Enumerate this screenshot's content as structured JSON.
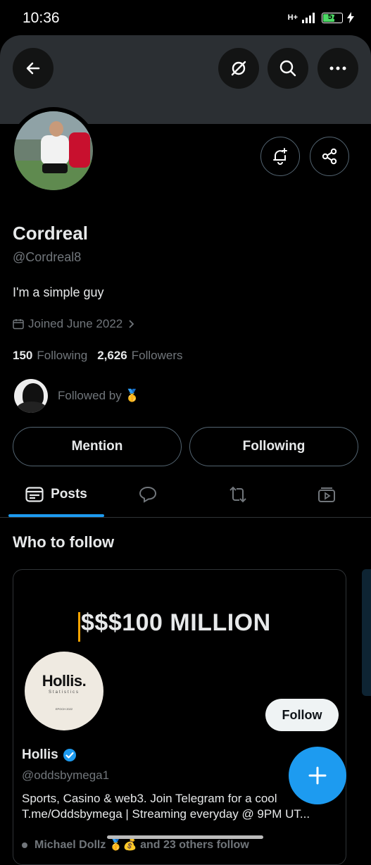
{
  "status_bar": {
    "time": "10:36",
    "network": "H+",
    "battery": "57"
  },
  "profile": {
    "name": "Cordreal",
    "handle": "@Cordreal8",
    "bio": "I'm a simple guy",
    "joined": "Joined June 2022",
    "following_count": "150",
    "following_label": "Following",
    "followers_count": "2,626",
    "followers_label": "Followers",
    "followed_by": "Followed by 🥇"
  },
  "actions": {
    "mention": "Mention",
    "following": "Following"
  },
  "tabs": [
    {
      "label": "Posts",
      "icon": "posts-icon"
    },
    {
      "icon": "replies-icon"
    },
    {
      "icon": "repost-icon"
    },
    {
      "icon": "media-icon"
    }
  ],
  "who_to_follow": {
    "title": "Who to follow",
    "card": {
      "headline": "$$$100 MILLION",
      "logo_text": "Hollis.",
      "logo_sub": "Statistics",
      "logo_tag": "EPOCH 2022",
      "name": "Hollis",
      "handle": "@oddsbymega1",
      "desc_line1": "Sports, Casino & web3. Join Telegram for a cool",
      "desc_line2": "T.me/Oddsbymega | Streaming everyday @ 9PM UT...",
      "followed_by": "Michael Dollz 🥇💰 and 23 others follow",
      "follow_label": "Follow"
    }
  },
  "colors": {
    "accent": "#1d9bf0",
    "muted": "#71767b",
    "border": "#536471",
    "banner": "#2b2f33"
  }
}
